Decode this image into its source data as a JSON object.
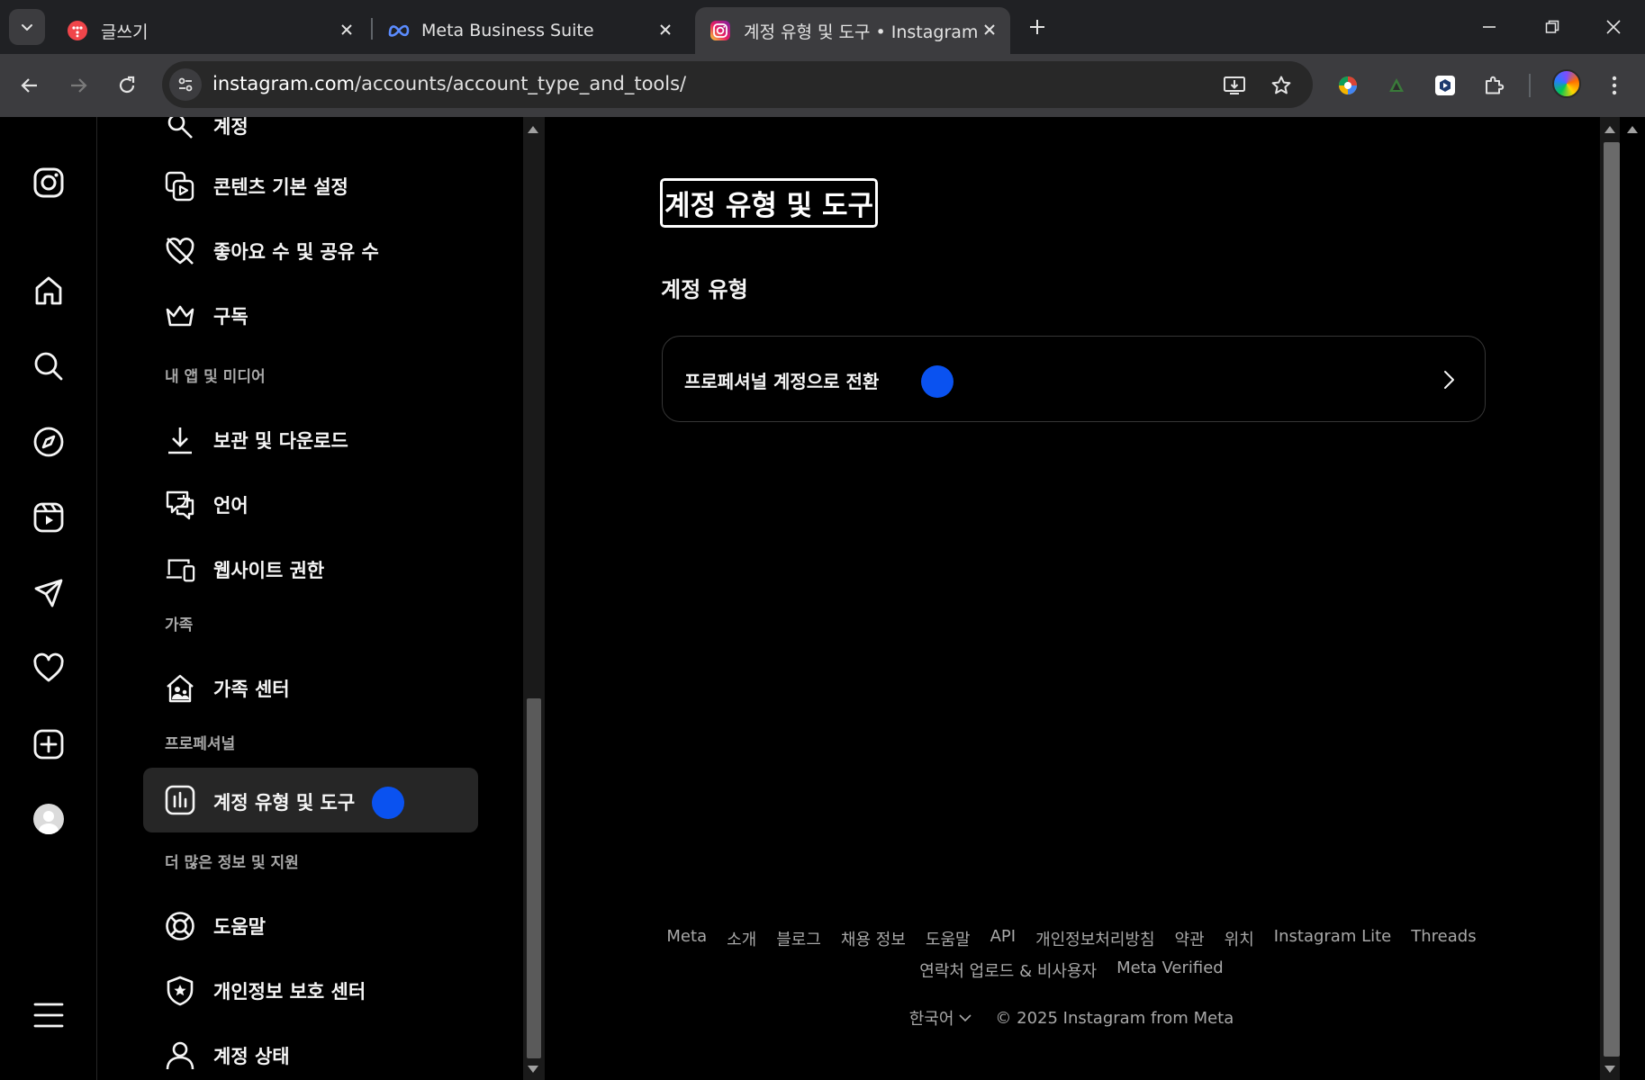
{
  "browser": {
    "tabs": [
      {
        "title": "글쓰기",
        "active": false
      },
      {
        "title": "Meta Business Suite",
        "active": false
      },
      {
        "title": "계정 유형 및 도구 • Instagram",
        "active": true
      }
    ],
    "url_host": "instagram.com",
    "url_path": "/accounts/account_type_and_tools/",
    "icons": [
      "tab-search-icon",
      "close-icon",
      "new-tab-icon",
      "minimize-icon",
      "restore-icon",
      "window-close-icon",
      "back-icon",
      "forward-icon",
      "reload-icon",
      "site-info-icon",
      "install-app-icon",
      "bookmark-star-icon",
      "extension-icon",
      "puzzle-icon",
      "menu-dots-icon"
    ]
  },
  "nav_rail": {
    "icons": [
      "instagram-logo-icon",
      "home-icon",
      "search-icon",
      "explore-icon",
      "reels-icon",
      "messages-icon",
      "notifications-heart-icon",
      "create-icon",
      "profile-avatar",
      "more-menu-icon"
    ]
  },
  "settings": {
    "items": [
      {
        "id": "account",
        "label": "계정",
        "icon": "account-search-icon"
      },
      {
        "id": "content-preferences",
        "label": "콘텐츠 기본 설정",
        "icon": "content-preferences-icon"
      },
      {
        "id": "like-share-counts",
        "label": "좋아요 수 및 공유 수",
        "icon": "heart-off-icon"
      },
      {
        "id": "subscriptions",
        "label": "구독",
        "icon": "crown-icon"
      }
    ],
    "section_apps": "내 앱 및 미디어",
    "apps_items": [
      {
        "id": "archive-download",
        "label": "보관 및 다운로드",
        "icon": "download-icon"
      },
      {
        "id": "language",
        "label": "언어",
        "icon": "language-icon"
      },
      {
        "id": "website-permissions",
        "label": "웹사이트 권한",
        "icon": "devices-icon"
      }
    ],
    "section_family": "가족",
    "family_items": [
      {
        "id": "family-center",
        "label": "가족 센터",
        "icon": "family-center-icon"
      }
    ],
    "section_professional": "프로페셔널",
    "professional_items": [
      {
        "id": "account-type-tools",
        "label": "계정 유형 및 도구",
        "icon": "insights-chart-icon",
        "selected": true
      }
    ],
    "section_more": "더 많은 정보 및 지원",
    "more_items": [
      {
        "id": "help",
        "label": "도움말",
        "icon": "lifebuoy-icon"
      },
      {
        "id": "privacy-center",
        "label": "개인정보 보호 센터",
        "icon": "shield-star-icon"
      },
      {
        "id": "account-status",
        "label": "계정 상태",
        "icon": "person-icon"
      }
    ]
  },
  "main": {
    "title": "계정 유형 및 도구",
    "section_heading": "계정 유형",
    "switch_card_label": "프로페셔널 계정으로 전환"
  },
  "footer": {
    "links_row1": [
      "Meta",
      "소개",
      "블로그",
      "채용 정보",
      "도움말",
      "API",
      "개인정보처리방침",
      "약관",
      "위치",
      "Instagram Lite",
      "Threads"
    ],
    "links_row2": [
      "연락처 업로드 & 비사용자",
      "Meta Verified"
    ],
    "language": "한국어",
    "copyright": "© 2025 Instagram from Meta"
  },
  "colors": {
    "background": "#000000",
    "selected_item": "#262626",
    "accent_dot": "#0a52f0",
    "secondary_text": "#a8a8a8"
  }
}
